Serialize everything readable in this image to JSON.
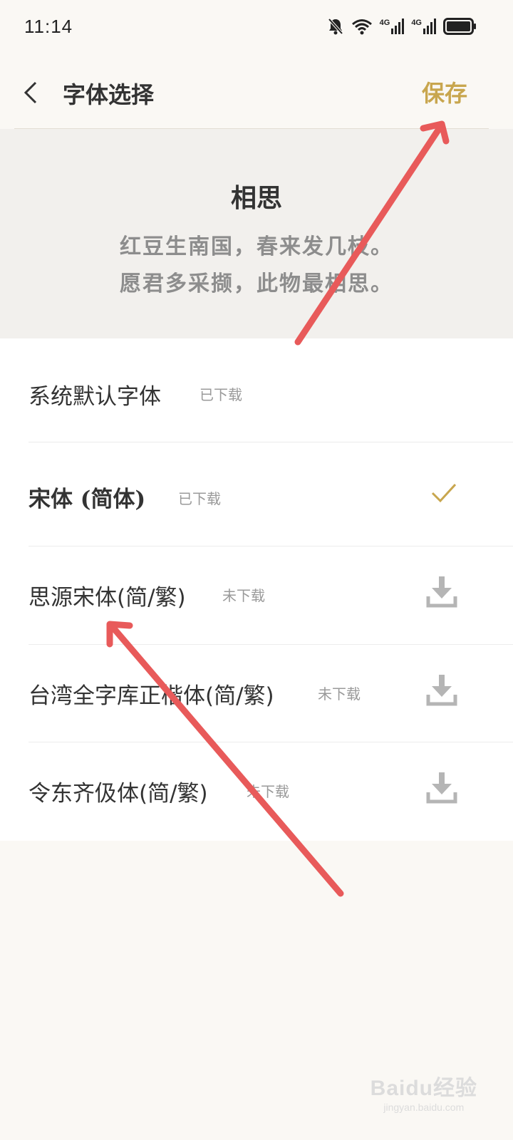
{
  "status_bar": {
    "time": "11:14",
    "icons": [
      "bell-off-icon",
      "wifi-icon",
      "signal-4g-icon",
      "signal-4g-icon",
      "battery-icon"
    ],
    "net_label_1": "4G",
    "net_label_2": "4G"
  },
  "header": {
    "back_icon": "chevron-left-icon",
    "title": "字体选择",
    "save_label": "保存"
  },
  "preview": {
    "poem_title": "相思",
    "line_1": "红豆生南国，春来发几枝。",
    "line_2": "愿君多采撷，此物最相思。"
  },
  "fonts": [
    {
      "name": "系统默认字体",
      "status": "已下载",
      "action": "none"
    },
    {
      "name": "宋体 (简体)",
      "status": "已下载",
      "action": "check-icon"
    },
    {
      "name": "思源宋体(简/繁)",
      "status": "未下载",
      "action": "download-icon"
    },
    {
      "name": "台湾全字库正楷体(简/繁)",
      "status": "未下载",
      "action": "download-icon"
    },
    {
      "name": "令东齐伋体(简/繁)",
      "status": "未下载",
      "action": "download-icon"
    }
  ],
  "colors": {
    "accent": "#c8a64e",
    "annotation_arrow": "#e85a5a",
    "status_gray": "#9a9a9a",
    "icon_gray": "#b5b5b5"
  },
  "watermark": {
    "main": "Baidu经验",
    "sub": "jingyan.baidu.com"
  }
}
